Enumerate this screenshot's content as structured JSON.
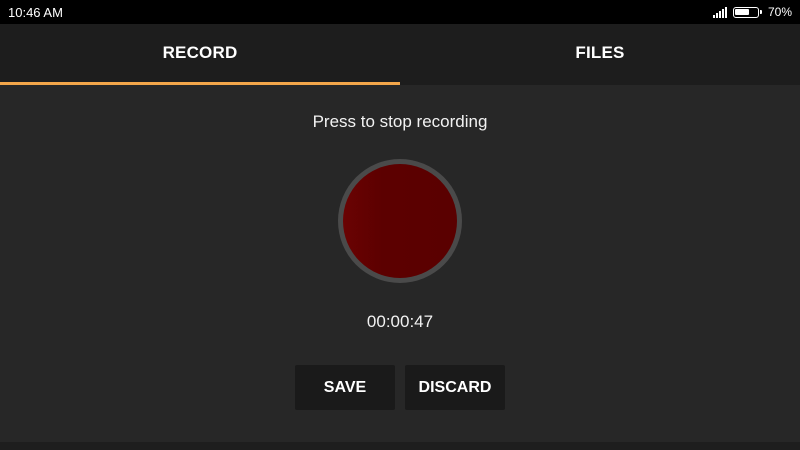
{
  "status_bar": {
    "time": "10:46 AM",
    "signal_icon": "signal-icon",
    "battery_icon": "battery-icon",
    "battery_level": 0.7,
    "battery_text": "70%"
  },
  "tabs": [
    {
      "label": "RECORD",
      "selected": true
    },
    {
      "label": "FILES",
      "selected": false
    }
  ],
  "colors": {
    "tab_indicator": "#f3a64a",
    "record_button": "#5c0000",
    "background": "#272727"
  },
  "recorder": {
    "prompt": "Press to stop recording",
    "elapsed": "00:00:47",
    "record_icon": "record-stop-button"
  },
  "actions": {
    "save_label": "SAVE",
    "discard_label": "DISCARD"
  }
}
